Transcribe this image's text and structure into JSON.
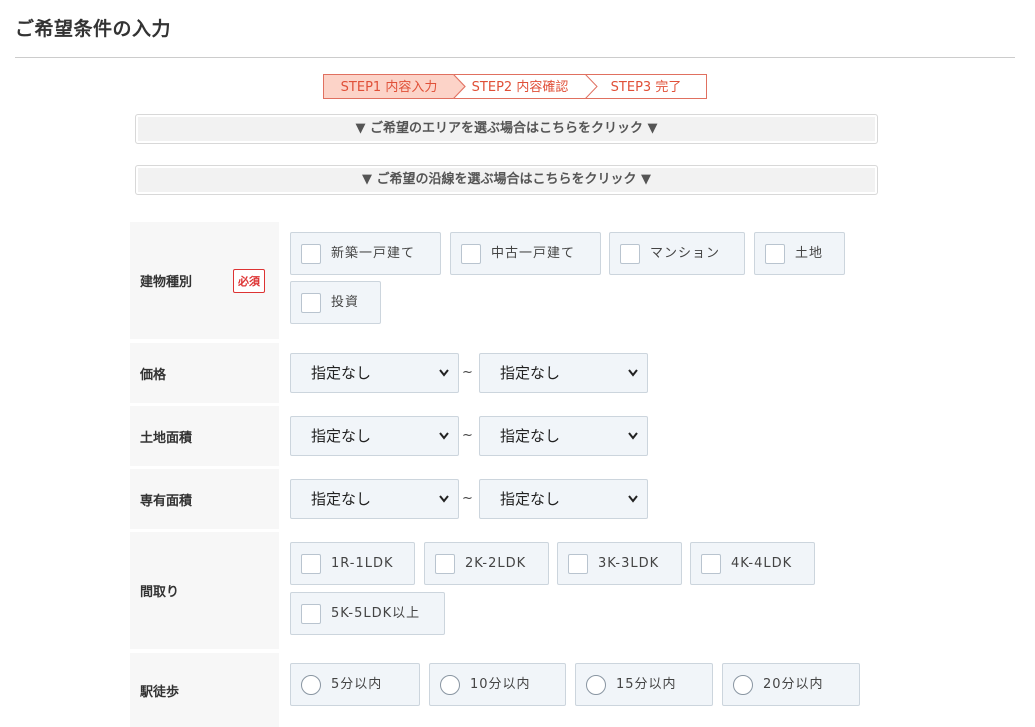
{
  "page": {
    "title": "ご希望条件の入力"
  },
  "steps": [
    {
      "label": "STEP1 内容入力",
      "active": true
    },
    {
      "label": "STEP2 内容確認",
      "active": false
    },
    {
      "label": "STEP3 完了",
      "active": false
    }
  ],
  "toggles": {
    "area": "▼ ご希望のエリアを選ぶ場合はこちらをクリック ▼",
    "line": "▼ ご希望の沿線を選ぶ場合はこちらをクリック ▼"
  },
  "form": {
    "building_type": {
      "label": "建物種別",
      "required_badge": "必須",
      "options": [
        "新築一戸建て",
        "中古一戸建て",
        "マンション",
        "土地",
        "投資"
      ]
    },
    "price": {
      "label": "価格",
      "min_value": "指定なし",
      "max_value": "指定なし",
      "separator": "~"
    },
    "land_area": {
      "label": "土地面積",
      "min_value": "指定なし",
      "max_value": "指定なし",
      "separator": "~"
    },
    "floor_area": {
      "label": "専有面積",
      "min_value": "指定なし",
      "max_value": "指定なし",
      "separator": "~"
    },
    "layout": {
      "label": "間取り",
      "options": [
        "1R-1LDK",
        "2K-2LDK",
        "3K-3LDK",
        "4K-4LDK",
        "5K-5LDK以上"
      ]
    },
    "walk": {
      "label": "駅徒歩",
      "options": [
        "5分以内",
        "10分以内",
        "15分以内",
        "20分以内"
      ]
    }
  },
  "colors": {
    "accent": "#e05038",
    "step_active_bg": "#fcd3c8",
    "field_bg": "#f1f5f9",
    "label_bg": "#f7f7f7",
    "required": "#dd3333"
  }
}
